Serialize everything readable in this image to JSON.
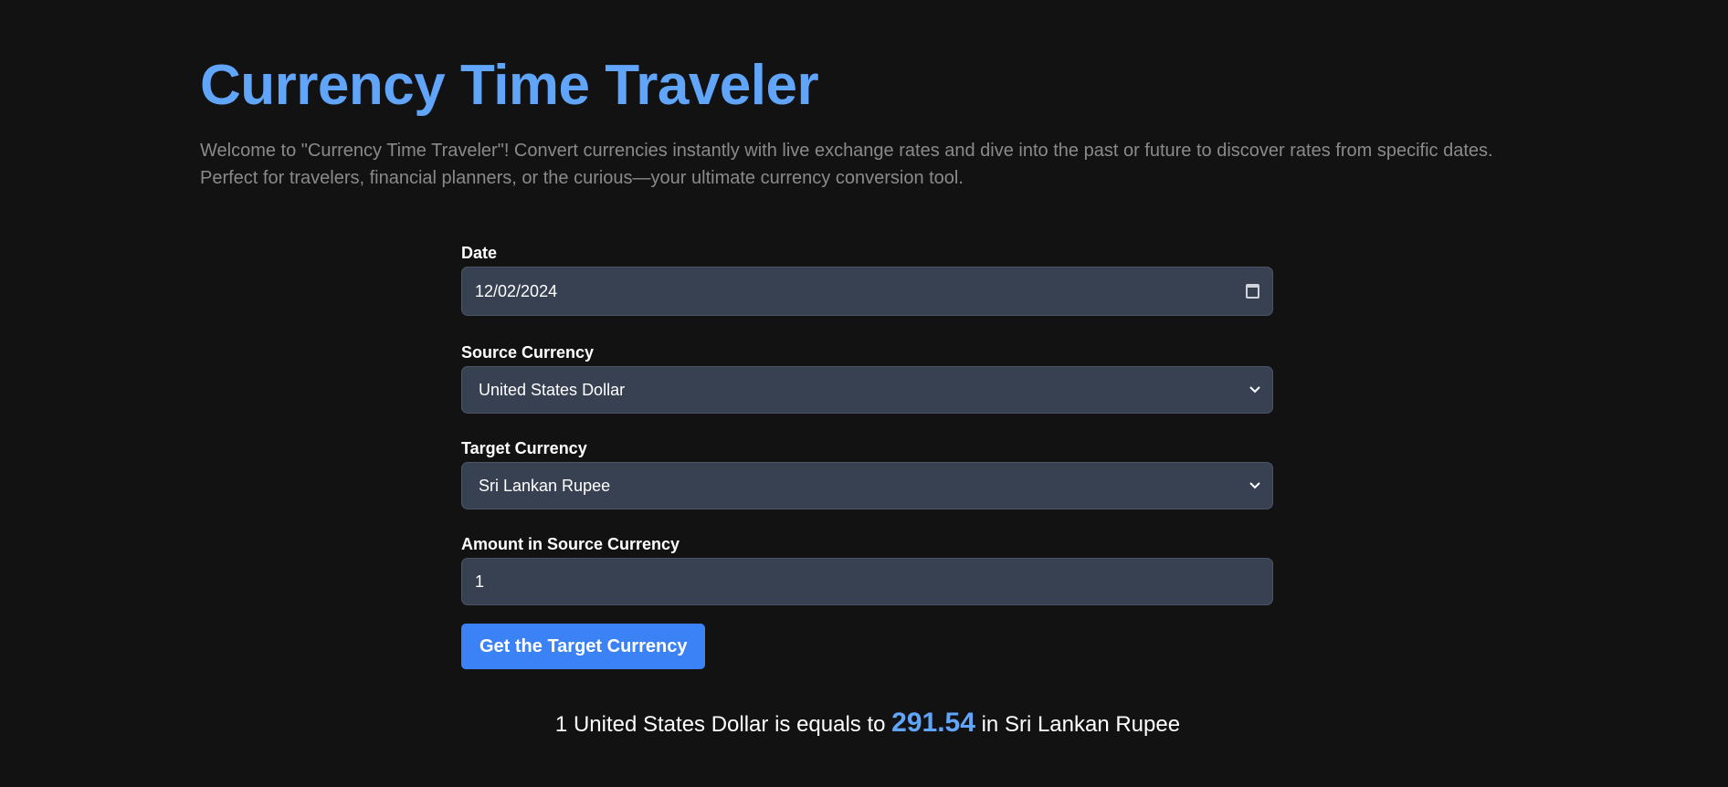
{
  "header": {
    "title": "Currency Time Traveler",
    "intro": "Welcome to \"Currency Time Traveler\"! Convert currencies instantly with live exchange rates and dive into the past or future to discover rates from specific dates. Perfect for travelers, financial planners, or the curious—your ultimate currency conversion tool."
  },
  "form": {
    "date_label": "Date",
    "date_value": "12/02/2024",
    "source_label": "Source Currency",
    "source_value": "United States Dollar",
    "target_label": "Target Currency",
    "target_value": "Sri Lankan Rupee",
    "amount_label": "Amount in Source Currency",
    "amount_value": "1",
    "submit_label": "Get the Target Currency"
  },
  "result": {
    "amount": "1",
    "source_currency": "United States Dollar",
    "connector": "is equals to",
    "rate": "291.54",
    "preposition": "in",
    "target_currency": "Sri Lankan Rupee"
  },
  "colors": {
    "background": "#121212",
    "accent": "#60a5fa",
    "button": "#3b82f6",
    "input_bg": "#374151"
  },
  "icons": {
    "date": "calendar-icon",
    "select": "chevron-down-icon"
  }
}
